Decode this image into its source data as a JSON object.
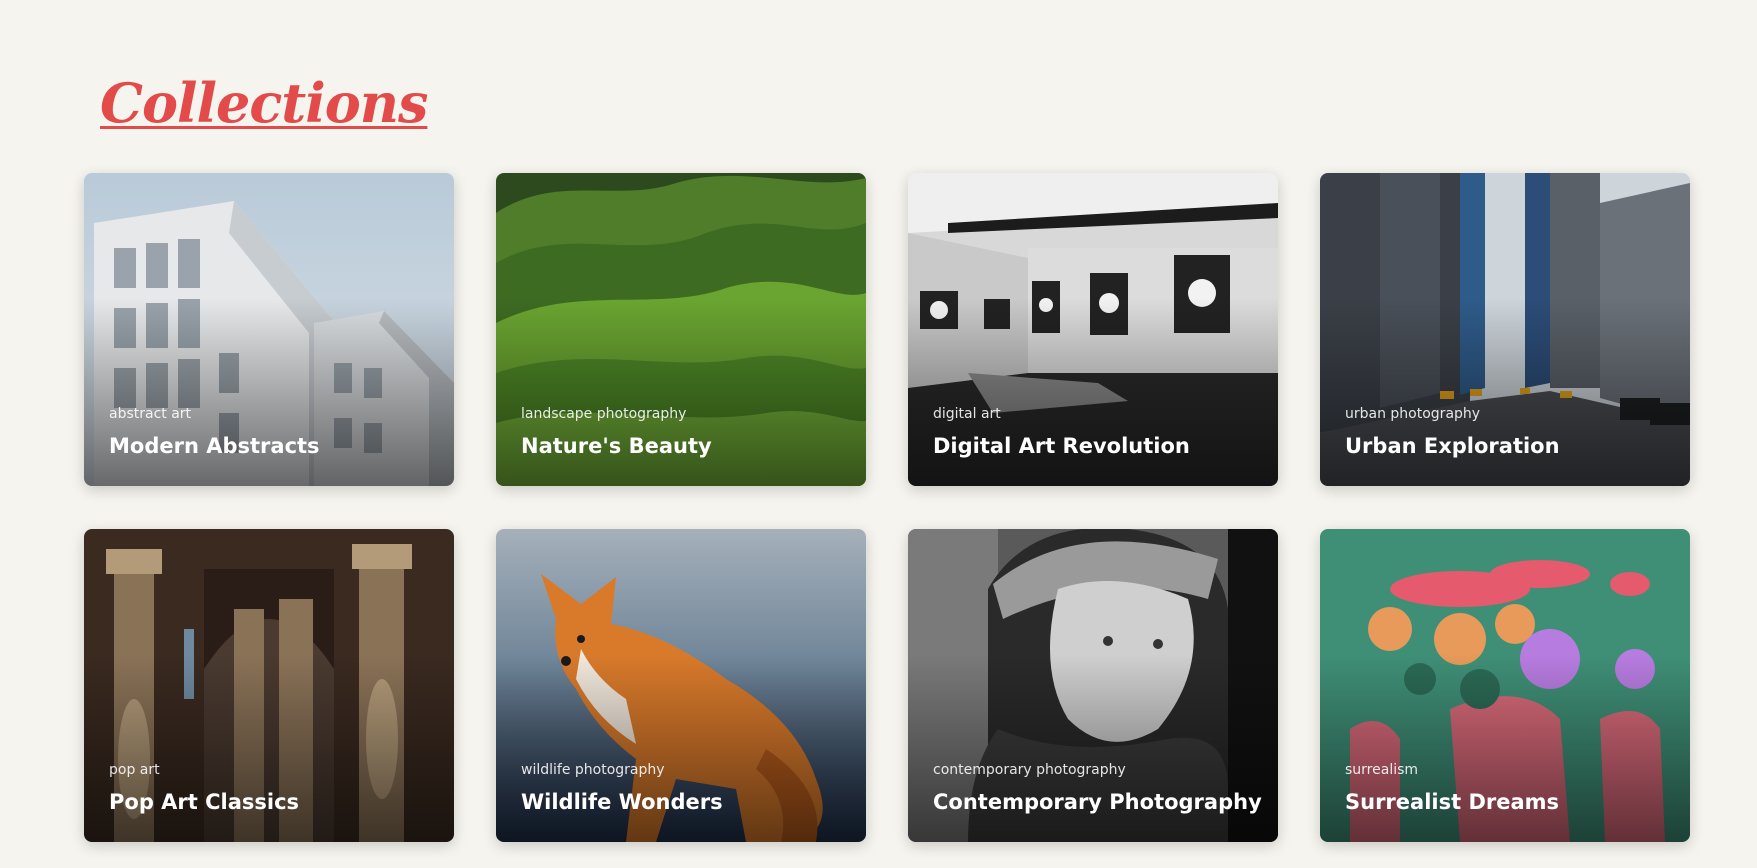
{
  "header": {
    "title": "Collections"
  },
  "collections": [
    {
      "category": "abstract art",
      "title": "Modern Abstracts"
    },
    {
      "category": "landscape photography",
      "title": "Nature's Beauty"
    },
    {
      "category": "digital art",
      "title": "Digital Art Revolution"
    },
    {
      "category": "urban photography",
      "title": "Urban Exploration"
    },
    {
      "category": "pop art",
      "title": "Pop Art Classics"
    },
    {
      "category": "wildlife photography",
      "title": "Wildlife Wonders"
    },
    {
      "category": "contemporary photography",
      "title": "Contemporary Photography"
    },
    {
      "category": "surrealism",
      "title": "Surrealist Dreams"
    }
  ],
  "colors": {
    "accent": "#e34b4b",
    "background": "#f6f4ee"
  }
}
